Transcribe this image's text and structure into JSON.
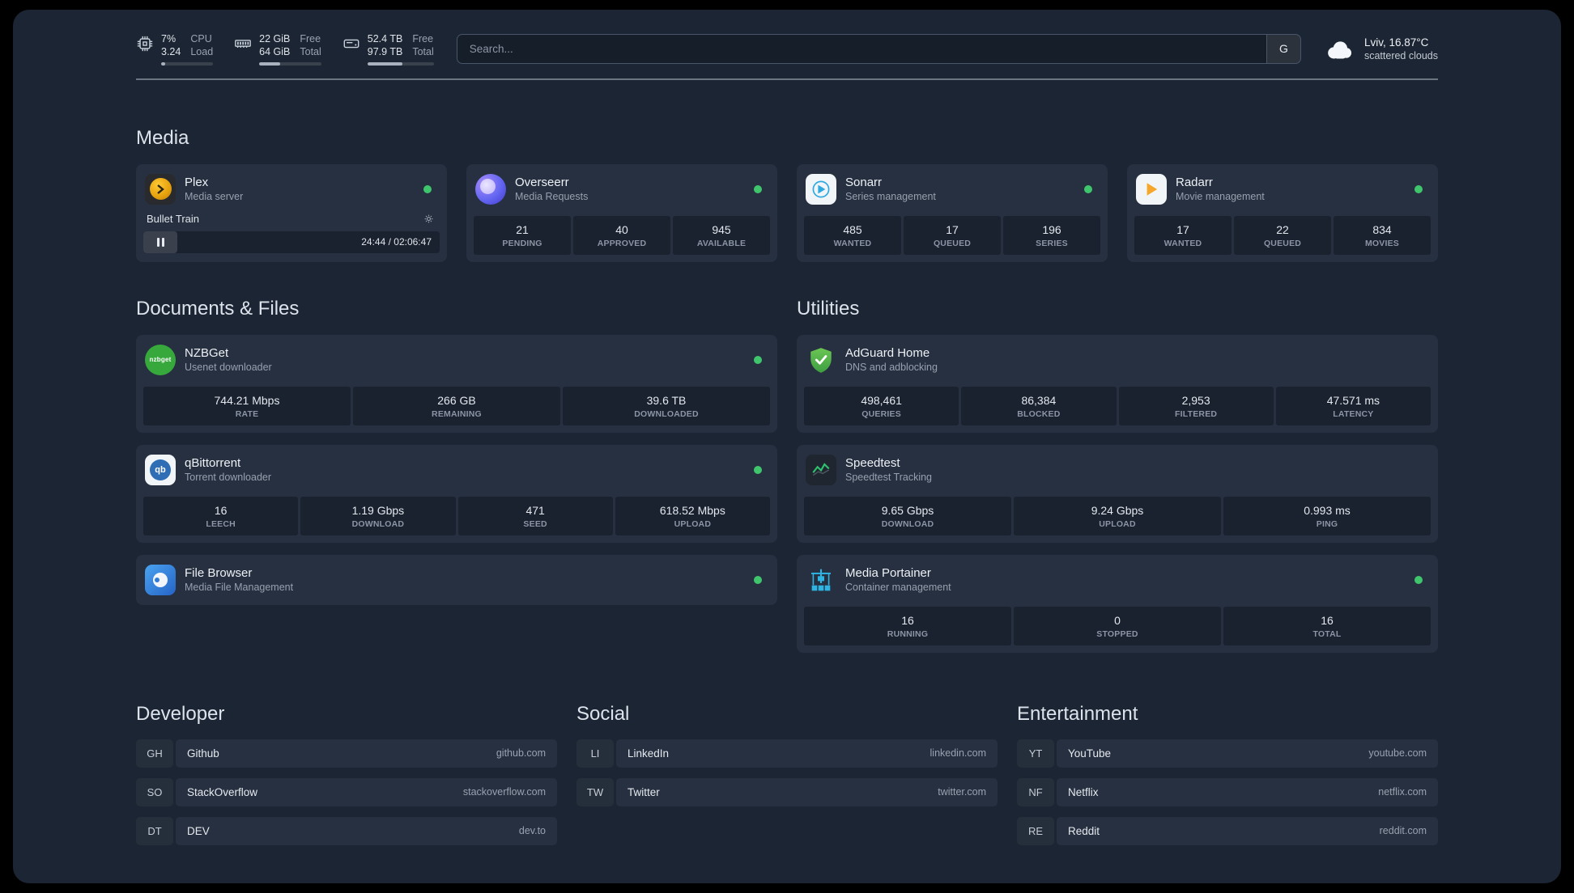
{
  "topbar": {
    "resources": [
      {
        "name": "cpu",
        "primary": "7%",
        "secondary": "3.24",
        "label_top": "CPU",
        "label_bottom": "Load"
      },
      {
        "name": "memory",
        "primary": "22 GiB",
        "secondary": "64 GiB",
        "label_top": "Free",
        "label_bottom": "Total"
      },
      {
        "name": "disk",
        "primary": "52.4 TB",
        "secondary": "97.9 TB",
        "label_top": "Free",
        "label_bottom": "Total"
      }
    ],
    "search": {
      "placeholder": "Search...",
      "button_label": "G"
    },
    "weather": {
      "location": "Lviv, 16.87°C",
      "condition": "scattered clouds"
    }
  },
  "colors": {
    "status_online": "#3fc56b",
    "accent_green": "#3fc56b"
  },
  "sections": {
    "media": {
      "title": "Media",
      "plex": {
        "name": "Plex",
        "subtitle": "Media server",
        "now_playing": "Bullet Train",
        "time": "24:44 / 02:06:47"
      },
      "overseerr": {
        "name": "Overseerr",
        "subtitle": "Media Requests",
        "stats": [
          {
            "value": "21",
            "label": "PENDING"
          },
          {
            "value": "40",
            "label": "APPROVED"
          },
          {
            "value": "945",
            "label": "AVAILABLE"
          }
        ]
      },
      "sonarr": {
        "name": "Sonarr",
        "subtitle": "Series management",
        "stats": [
          {
            "value": "485",
            "label": "WANTED"
          },
          {
            "value": "17",
            "label": "QUEUED"
          },
          {
            "value": "196",
            "label": "SERIES"
          }
        ]
      },
      "radarr": {
        "name": "Radarr",
        "subtitle": "Movie management",
        "stats": [
          {
            "value": "17",
            "label": "WANTED"
          },
          {
            "value": "22",
            "label": "QUEUED"
          },
          {
            "value": "834",
            "label": "MOVIES"
          }
        ]
      }
    },
    "documents": {
      "title": "Documents & Files",
      "nzbget": {
        "name": "NZBGet",
        "subtitle": "Usenet downloader",
        "icon_text": "nzbget",
        "stats": [
          {
            "value": "744.21 Mbps",
            "label": "RATE"
          },
          {
            "value": "266 GB",
            "label": "REMAINING"
          },
          {
            "value": "39.6 TB",
            "label": "DOWNLOADED"
          }
        ]
      },
      "qbittorrent": {
        "name": "qBittorrent",
        "subtitle": "Torrent downloader",
        "icon_text": "qb",
        "stats": [
          {
            "value": "16",
            "label": "LEECH"
          },
          {
            "value": "1.19 Gbps",
            "label": "DOWNLOAD"
          },
          {
            "value": "471",
            "label": "SEED"
          },
          {
            "value": "618.52 Mbps",
            "label": "UPLOAD"
          }
        ]
      },
      "filebrowser": {
        "name": "File Browser",
        "subtitle": "Media File Management"
      }
    },
    "utilities": {
      "title": "Utilities",
      "adguard": {
        "name": "AdGuard Home",
        "subtitle": "DNS and adblocking",
        "stats": [
          {
            "value": "498,461",
            "label": "QUERIES"
          },
          {
            "value": "86,384",
            "label": "BLOCKED"
          },
          {
            "value": "2,953",
            "label": "FILTERED"
          },
          {
            "value": "47.571 ms",
            "label": "LATENCY"
          }
        ]
      },
      "speedtest": {
        "name": "Speedtest",
        "subtitle": "Speedtest Tracking",
        "stats": [
          {
            "value": "9.65 Gbps",
            "label": "DOWNLOAD"
          },
          {
            "value": "9.24 Gbps",
            "label": "UPLOAD"
          },
          {
            "value": "0.993 ms",
            "label": "PING"
          }
        ]
      },
      "portainer": {
        "name": "Media Portainer",
        "subtitle": "Container management",
        "stats": [
          {
            "value": "16",
            "label": "RUNNING"
          },
          {
            "value": "0",
            "label": "STOPPED"
          },
          {
            "value": "16",
            "label": "TOTAL"
          }
        ]
      }
    }
  },
  "bookmarks": [
    {
      "title": "Developer",
      "items": [
        {
          "abbr": "GH",
          "label": "Github",
          "url": "github.com"
        },
        {
          "abbr": "SO",
          "label": "StackOverflow",
          "url": "stackoverflow.com"
        },
        {
          "abbr": "DT",
          "label": "DEV",
          "url": "dev.to"
        }
      ]
    },
    {
      "title": "Social",
      "items": [
        {
          "abbr": "LI",
          "label": "LinkedIn",
          "url": "linkedin.com"
        },
        {
          "abbr": "TW",
          "label": "Twitter",
          "url": "twitter.com"
        }
      ]
    },
    {
      "title": "Entertainment",
      "items": [
        {
          "abbr": "YT",
          "label": "YouTube",
          "url": "youtube.com"
        },
        {
          "abbr": "NF",
          "label": "Netflix",
          "url": "netflix.com"
        },
        {
          "abbr": "RE",
          "label": "Reddit",
          "url": "reddit.com"
        }
      ]
    }
  ]
}
